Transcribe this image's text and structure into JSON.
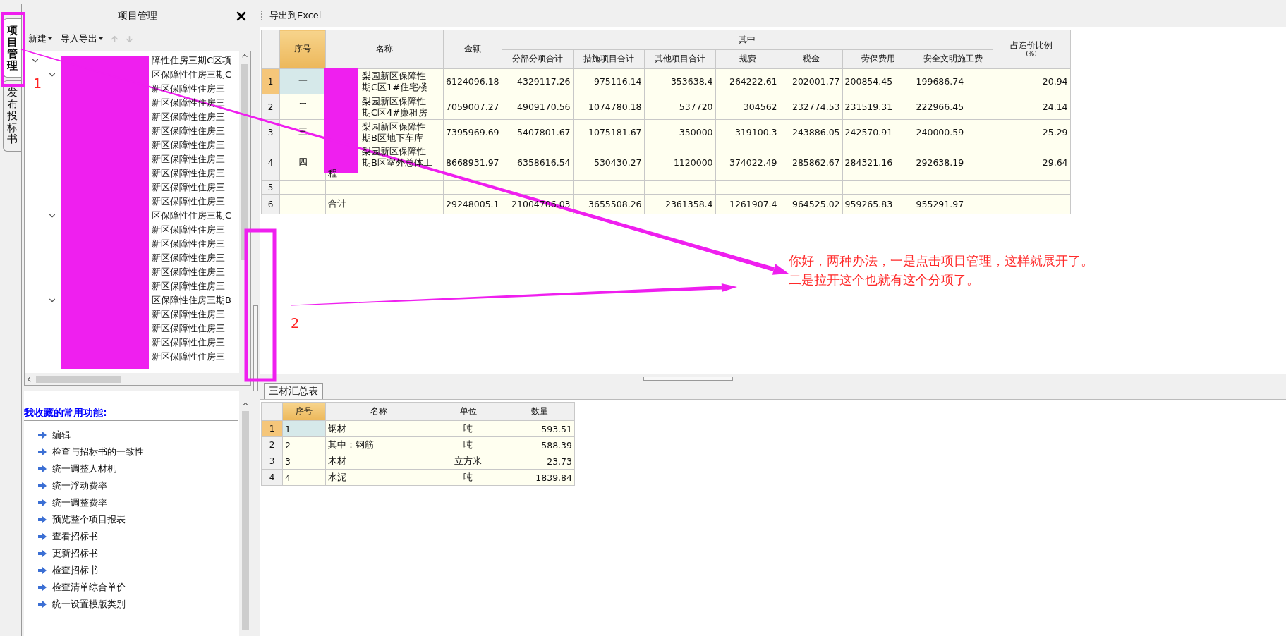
{
  "side_tabs": [
    {
      "label": "项目管理",
      "selected": true
    },
    {
      "label": "发布投标书",
      "selected": false
    }
  ],
  "project_panel": {
    "title": "项目管理",
    "toolbar": {
      "menus": [
        "新建",
        "导入导出"
      ],
      "arrows": [
        {
          "kind": "up",
          "disabled": true
        },
        {
          "kind": "down",
          "disabled": true
        }
      ]
    },
    "tree": [
      {
        "label": "障性住房三期C区项",
        "expanded": true,
        "children": [
          {
            "label": "区保障性住房三期C",
            "expanded": true,
            "children": [
              {
                "label": "新区保障性住房三"
              },
              {
                "label": "新区保障性住房三"
              },
              {
                "label": "新区保障性住房三"
              },
              {
                "label": "新区保障性住房三"
              },
              {
                "label": "新区保障性住房三"
              },
              {
                "label": "新区保障性住房三"
              },
              {
                "label": "新区保障性住房三"
              },
              {
                "label": "新区保障性住房三"
              },
              {
                "label": "新区保障性住房三"
              }
            ]
          },
          {
            "label": "区保障性住房三期C",
            "expanded": true,
            "children": [
              {
                "label": "新区保障性住房三"
              },
              {
                "label": "新区保障性住房三"
              },
              {
                "label": "新区保障性住房三"
              },
              {
                "label": "新区保障性住房三"
              },
              {
                "label": "新区保障性住房三"
              }
            ]
          },
          {
            "label": "区保障性住房三期B",
            "expanded": true,
            "children": [
              {
                "label": "新区保障性住房三"
              },
              {
                "label": "新区保障性住房三"
              },
              {
                "label": "新区保障性住房三"
              },
              {
                "label": "新区保障性住房三"
              }
            ]
          }
        ]
      }
    ]
  },
  "favorites": {
    "title": "我收藏的常用功能:",
    "items": [
      "编辑",
      "检查与招标书的一致性",
      "统一调整人材机",
      "统一浮动费率",
      "统一调整费率",
      "预览整个项目报表",
      "查看招标书",
      "更新招标书",
      "检查招标书",
      "检查清单综合单价",
      "统一设置模版类别"
    ]
  },
  "export_button": "导出到Excel",
  "main_table": {
    "columns": [
      {
        "label": "序号",
        "selected": true
      },
      {
        "label": "名称",
        "selected": false
      },
      {
        "label": "金额",
        "selected": false
      },
      {
        "label": "其中",
        "selected": false,
        "colspan": 7,
        "children": [
          {
            "label": "分部分项合计",
            "selected": false
          },
          {
            "label": "措施项目合计",
            "selected": false
          },
          {
            "label": "其他项目合计",
            "selected": false
          },
          {
            "label": "规费",
            "selected": false
          },
          {
            "label": "税金",
            "selected": false
          },
          {
            "label": "劳保费用",
            "selected": false
          },
          {
            "label": "安全文明施工费",
            "selected": false
          }
        ]
      },
      {
        "label": "占造价比例",
        "note": "(%)",
        "selected": false
      }
    ],
    "rows": [
      {
        "number": "1",
        "selected": true,
        "cells": [
          "一",
          {
            "lines": [
              "梨园新区保障性",
              "期C区1#住宅楼"
            ]
          },
          "6124096.18",
          "4329117.26",
          "975116.14",
          "353638.4",
          "264222.61",
          "202001.77",
          "200854.45",
          "199686.74",
          "20.94"
        ]
      },
      {
        "number": "2",
        "selected": false,
        "cells": [
          "二",
          {
            "lines": [
              "梨园新区保障性",
              "期C区4#廉租房"
            ]
          },
          "7059007.27",
          "4909170.56",
          "1074780.18",
          "537720",
          "304562",
          "232774.53",
          "231519.31",
          "222966.45",
          "24.14"
        ]
      },
      {
        "number": "3",
        "selected": false,
        "cells": [
          "三",
          {
            "lines": [
              "梨园新区保障性",
              "期B区地下车库"
            ]
          },
          "7395969.69",
          "5407801.67",
          "1075181.67",
          "350000",
          "319100.3",
          "243886.05",
          "242570.91",
          "240000.59",
          "25.29"
        ]
      },
      {
        "number": "4",
        "selected": false,
        "cells": [
          "四",
          {
            "lines": [
              "梨园新区保障性",
              "期B区室外总体工",
              "程"
            ]
          },
          "8668931.97",
          "6358616.54",
          "530430.27",
          "1120000",
          "374022.49",
          "285862.67",
          "284321.16",
          "292638.19",
          "29.64"
        ]
      },
      {
        "number": "5",
        "selected": false,
        "cells": []
      },
      {
        "number": "6",
        "selected": false,
        "cells": [
          null,
          "合计",
          "29248005.1",
          "21004706.03",
          "3655508.26",
          "2361358.4",
          "1261907.4",
          "964525.02",
          "959265.83",
          "955291.97",
          null
        ]
      }
    ]
  },
  "bottom_tab": {
    "label": "三材汇总表",
    "selected": true
  },
  "materials_table": {
    "columns": [
      {
        "label": "序号",
        "selected": true
      },
      {
        "label": "名称",
        "selected": false
      },
      {
        "label": "单位",
        "selected": false
      },
      {
        "label": "数量",
        "selected": false
      }
    ],
    "rows": [
      {
        "number": "1",
        "selected": true,
        "cells": [
          "1",
          "钢材",
          "吨",
          "593.51"
        ]
      },
      {
        "number": "2",
        "selected": false,
        "cells": [
          "2",
          "其中：钢筋",
          "吨",
          "588.39"
        ]
      },
      {
        "number": "3",
        "selected": false,
        "cells": [
          "3",
          "木材",
          "立方米",
          "23.73"
        ]
      },
      {
        "number": "4",
        "selected": false,
        "cells": [
          "4",
          "水泥",
          "吨",
          "1839.84"
        ]
      }
    ]
  },
  "annotations": {
    "markers": [
      "1",
      "2"
    ],
    "note": [
      "你好，两种办法，一是点击项目管理，这样就展开了。",
      "二是拉开这个也就有这个分项了。"
    ]
  }
}
